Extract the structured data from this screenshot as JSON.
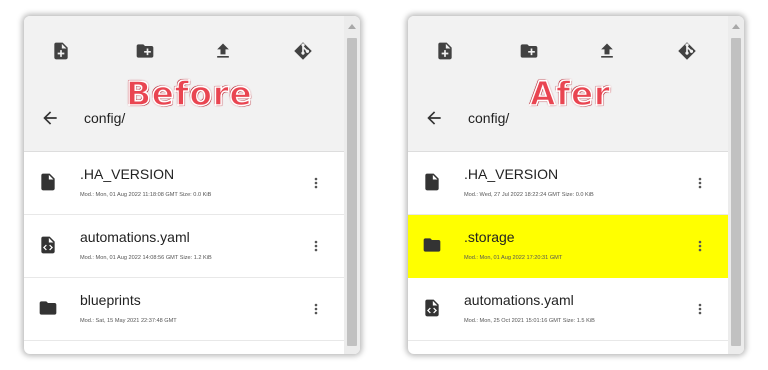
{
  "before": {
    "stamp": "Before",
    "path": "config/",
    "files": [
      {
        "icon": "file-icon",
        "name": ".HA_VERSION",
        "meta": "Mod.: Mon, 01 Aug 2022 11:18:08 GMT  Size: 0.0 KiB"
      },
      {
        "icon": "code-file-icon",
        "name": "automations.yaml",
        "meta": "Mod.: Mon, 01 Aug 2022 14:08:56 GMT  Size: 1.2 KiB"
      },
      {
        "icon": "folder-icon",
        "name": "blueprints",
        "meta": "Mod.: Sat, 15 May 2021 22:37:48 GMT"
      }
    ]
  },
  "after": {
    "stamp": "Afer",
    "path": "config/",
    "files": [
      {
        "icon": "file-icon",
        "name": ".HA_VERSION",
        "meta": "Mod.: Wed, 27 Jul 2022 18:22:24 GMT  Size: 0.0 KiB"
      },
      {
        "icon": "folder-icon",
        "name": ".storage",
        "meta": "Mod.: Mon, 01 Aug 2022 17:20:31 GMT",
        "highlighted": true
      },
      {
        "icon": "code-file-icon",
        "name": "automations.yaml",
        "meta": "Mod.: Mon, 25 Oct 2021 15:01:16 GMT  Size: 1.5 KiB"
      }
    ]
  },
  "toolbar": [
    "new-file-icon",
    "new-folder-icon",
    "upload-icon",
    "git-icon"
  ],
  "colors": {
    "stamp": "#e94551",
    "highlight": "#ffff00",
    "header_bg": "#f2f2f2"
  }
}
